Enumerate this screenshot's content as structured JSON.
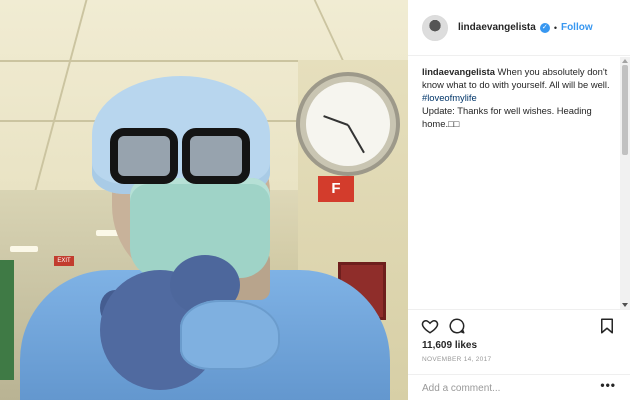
{
  "post": {
    "username": "lindaevangelista",
    "verified_icon": "verified-badge-icon",
    "separator": "•",
    "follow_label": "Follow",
    "caption_username": "lindaevangelista",
    "caption_text": " When you absolutely don't know what to do with yourself. All will be well. ",
    "hashtag": "#loveofmylife",
    "update_text": "Update: Thanks for well wishes. Heading home.",
    "update_glyphs": "□□",
    "likes": "11,609 likes",
    "date": "NOVEMBER 14, 2017",
    "comment_placeholder": "Add a comment...",
    "more_label": "•••"
  },
  "photo": {
    "fire_sign_text": "F",
    "exit_sign_text": "EXIT"
  },
  "icons": {
    "like": "heart-icon",
    "comment": "comment-icon",
    "save": "bookmark-icon"
  },
  "colors": {
    "accent": "#3897f0",
    "text": "#262626",
    "muted": "#999999",
    "hashtag": "#003569"
  }
}
